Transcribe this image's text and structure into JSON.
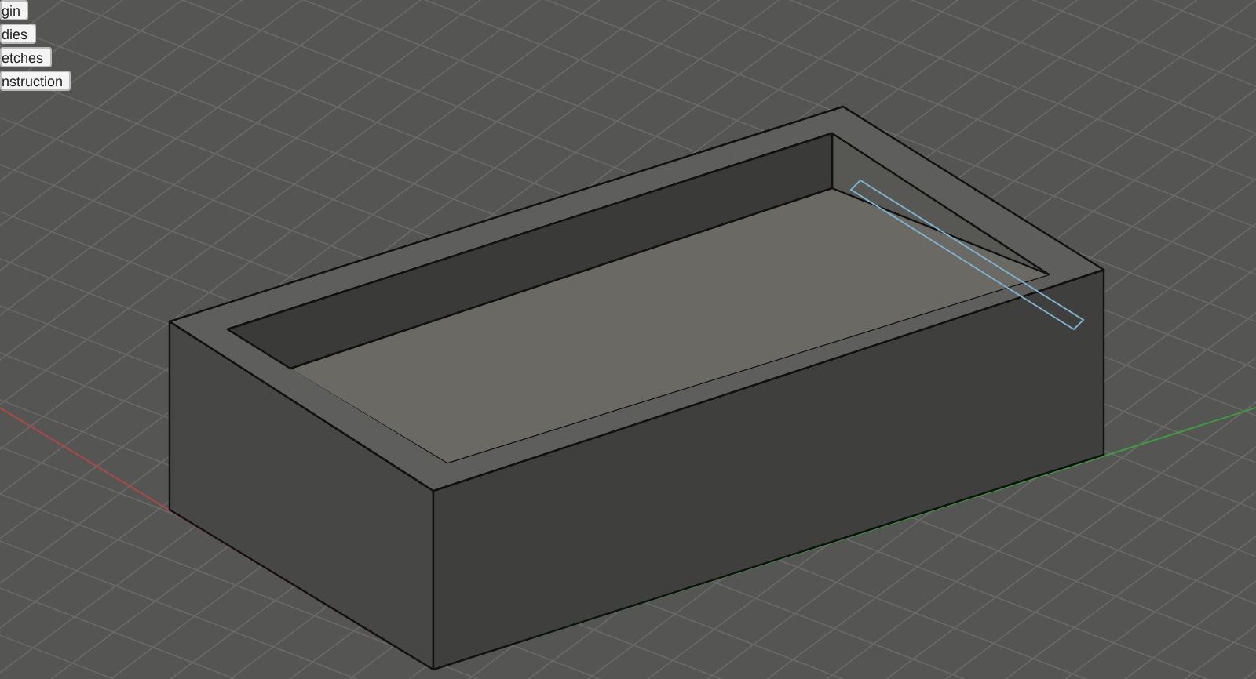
{
  "browser_items": [
    {
      "label": "gin"
    },
    {
      "label": "dies"
    },
    {
      "label": "etches"
    },
    {
      "label": "nstruction"
    }
  ]
}
